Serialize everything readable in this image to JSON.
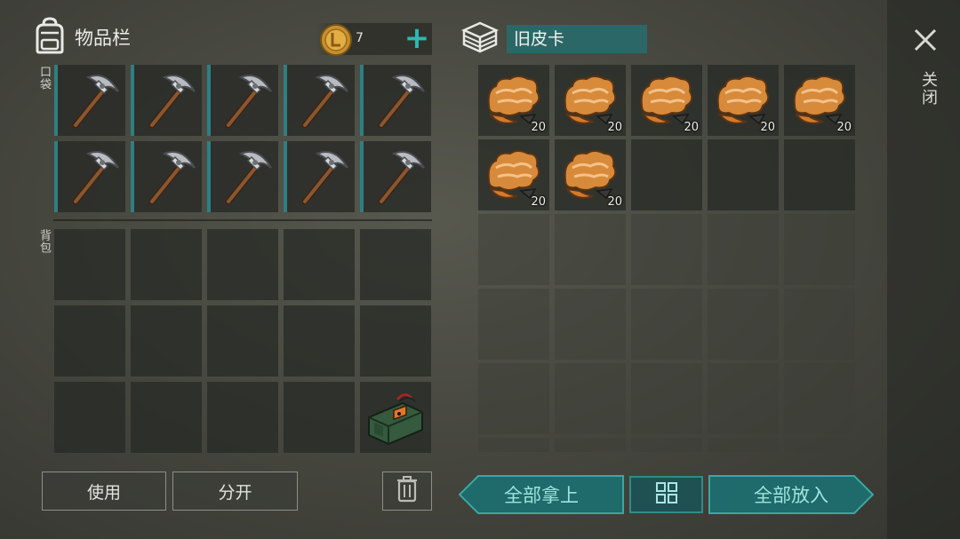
{
  "inventory": {
    "title": "物品栏",
    "pocket_label": "口袋",
    "backpack_label": "背包",
    "currency_amount": "7",
    "pocket_items": [
      {
        "item": "pickaxe-icon"
      },
      {
        "item": "pickaxe-icon"
      },
      {
        "item": "pickaxe-icon"
      },
      {
        "item": "pickaxe-icon"
      },
      {
        "item": "pickaxe-icon"
      },
      {
        "item": "pickaxe-icon"
      },
      {
        "item": "pickaxe-icon"
      },
      {
        "item": "pickaxe-icon"
      },
      {
        "item": "pickaxe-icon"
      },
      {
        "item": "pickaxe-icon"
      }
    ],
    "backpack_items": [
      null,
      null,
      null,
      null,
      null,
      null,
      null,
      null,
      null,
      null,
      null,
      null,
      null,
      null,
      {
        "item": "explosive-charge-icon"
      }
    ]
  },
  "actions": {
    "use_label": "使用",
    "split_label": "分开"
  },
  "container": {
    "name": "旧皮卡",
    "slots": [
      {
        "item": "leather-icon",
        "qty": "20"
      },
      {
        "item": "leather-icon",
        "qty": "20"
      },
      {
        "item": "leather-icon",
        "qty": "20"
      },
      {
        "item": "leather-icon",
        "qty": "20"
      },
      {
        "item": "leather-icon",
        "qty": "20"
      },
      {
        "item": "leather-icon",
        "qty": "20"
      },
      {
        "item": "leather-icon",
        "qty": "20"
      },
      null,
      null,
      null
    ],
    "take_all_label": "全部拿上",
    "put_all_label": "全部放入"
  },
  "close_label": "关闭",
  "colors": {
    "accent_teal": "#2fb7b2",
    "button_teal": "#1f6e6e",
    "pocket_stripe": "#2f7f82"
  }
}
